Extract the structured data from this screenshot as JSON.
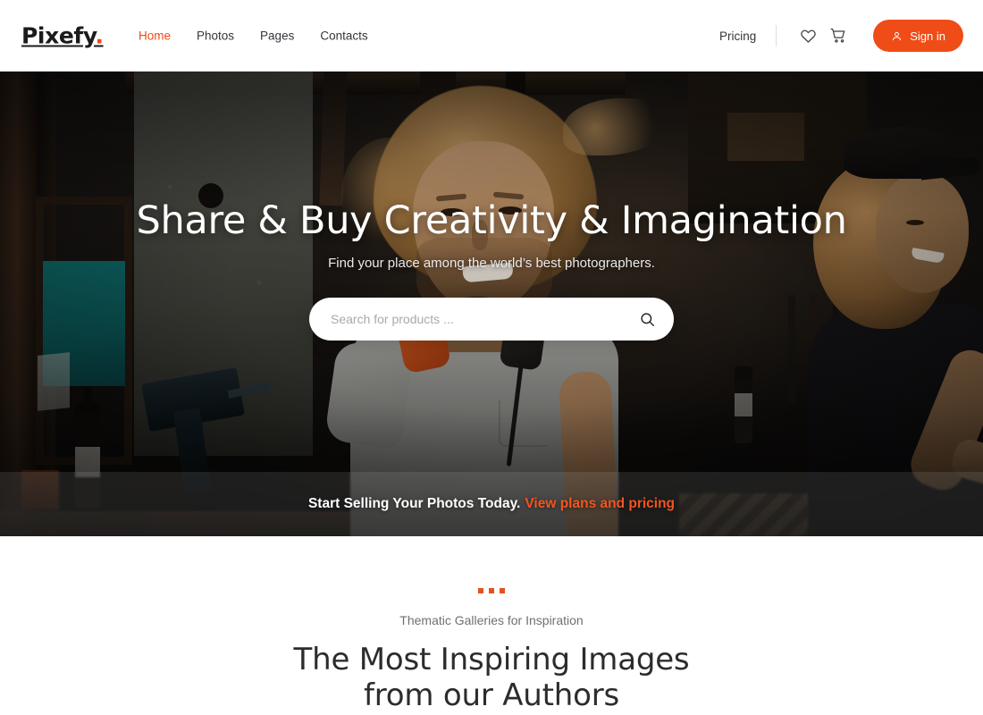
{
  "header": {
    "logo_text": "Pixefy",
    "logo_dot": ".",
    "nav": [
      {
        "label": "Home",
        "active": true
      },
      {
        "label": "Photos",
        "active": false
      },
      {
        "label": "Pages",
        "active": false
      },
      {
        "label": "Contacts",
        "active": false
      }
    ],
    "pricing_label": "Pricing",
    "wishlist_icon": "heart-icon",
    "cart_icon": "cart-icon",
    "signin_label": "Sign in",
    "signin_icon": "user-icon",
    "accent_color": "#ef4c18"
  },
  "hero": {
    "title": "Share & Buy Creativity & Imagination",
    "subtitle": "Find your place among the world’s best photographers.",
    "search": {
      "placeholder": "Search for products ...",
      "value": "",
      "icon": "search-icon"
    },
    "promo": {
      "text": "Start Selling Your Photos Today.",
      "link_label": "View plans and pricing",
      "link_color": "#f2551f"
    }
  },
  "section": {
    "dots_color": "#e2521f",
    "eyebrow": "Thematic Galleries for Inspiration",
    "title_line1": "The Most Inspiring Images",
    "title_line2": "from our Authors"
  }
}
